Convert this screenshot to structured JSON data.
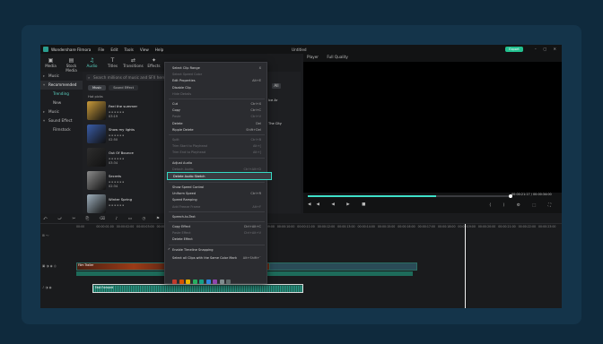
{
  "app": {
    "name": "Wondershare Filmora",
    "document": "Untitled",
    "export_label": "Export"
  },
  "menubar": [
    "File",
    "Edit",
    "Tools",
    "View",
    "Help"
  ],
  "window_controls": "– ▢ ✕",
  "library_tabs": [
    {
      "label": "Media",
      "icon": "▣"
    },
    {
      "label": "Stock Media",
      "icon": "▤"
    },
    {
      "label": "Audio",
      "icon": "♫"
    },
    {
      "label": "Titles",
      "icon": "T"
    },
    {
      "label": "Transitions",
      "icon": "⇄"
    },
    {
      "label": "Effects",
      "icon": "✦"
    }
  ],
  "sidebar": [
    {
      "label": "Music",
      "type": "group"
    },
    {
      "label": "Recommended",
      "type": "group-open",
      "selected": true
    },
    {
      "label": "Trending",
      "type": "sub",
      "highlight": true
    },
    {
      "label": "New",
      "type": "sub"
    },
    {
      "label": "Music",
      "type": "group"
    },
    {
      "label": "Sound Effect",
      "type": "group-open"
    },
    {
      "label": "Filmstock",
      "type": "sub"
    }
  ],
  "search": {
    "placeholder": "Search millions of music and SFX here"
  },
  "chips": [
    "Music",
    "Sound Effect"
  ],
  "section_label": "Hot picks",
  "items": [
    {
      "name": "Feel the summer",
      "duration": "03:19",
      "color": "#c99a3a"
    },
    {
      "name": "Show my lights",
      "duration": "02:50",
      "color": "#3a5da8"
    },
    {
      "name": "Out Of Bounce",
      "duration": "03:34",
      "color": "#2e2e2e"
    },
    {
      "name": "Secrets",
      "duration": "02:34",
      "color": "#8c8c8c"
    },
    {
      "name": "Winter Spring",
      "duration": "",
      "color": "#9fb0bd"
    }
  ],
  "right_col": [
    "Ice Ar",
    "The City"
  ],
  "all_label": "All",
  "player": {
    "label": "Player",
    "quality": "Full Quality",
    "time": "00:00:21:17",
    "total": "00:00:34:00"
  },
  "ruler_ticks": [
    "00:00",
    "00:00:01:00",
    "00:00:02:00",
    "00:00:03:00",
    "00:00:04:00",
    "00:00:05:00",
    "00:00:06:00",
    "00:00:07:00",
    "00:00:08:00",
    "00:00:09:00",
    "00:00:10:00",
    "00:00:11:00",
    "00:00:12:00",
    "00:00:13:00",
    "00:00:14:00",
    "00:00:15:00",
    "00:00:16:00",
    "00:00:17:00",
    "00:00:18:00",
    "00:00:19:00",
    "00:00:20:00",
    "00:00:21:00",
    "00:00:22:00",
    "00:00:23:00"
  ],
  "timeline": {
    "video_clip": "Film Trailer",
    "audio_clip": "Fast Forward"
  },
  "context_menu": {
    "items": [
      {
        "label": "Select Clip Range",
        "key": "X",
        "disabled": false
      },
      {
        "label": "Select Speed Color",
        "key": "",
        "disabled": true
      },
      {
        "label": "Edit Properties",
        "key": "Alt+E",
        "disabled": false
      },
      {
        "label": "Disable Clip",
        "key": "",
        "disabled": false
      },
      {
        "label": "Hide Details",
        "key": "",
        "disabled": true
      },
      {
        "label": "Cut",
        "key": "Ctrl+X",
        "disabled": false
      },
      {
        "label": "Copy",
        "key": "Ctrl+C",
        "disabled": false
      },
      {
        "label": "Paste",
        "key": "Ctrl+V",
        "disabled": true
      },
      {
        "label": "Delete",
        "key": "Del",
        "disabled": false
      },
      {
        "label": "Ripple Delete",
        "key": "Shift+Del",
        "disabled": false
      },
      {
        "label": "Split",
        "key": "Ctrl+B",
        "disabled": true
      },
      {
        "label": "Trim Start to Playhead",
        "key": "Alt+[",
        "disabled": true
      },
      {
        "label": "Trim End to Playhead",
        "key": "Alt+]",
        "disabled": true
      },
      {
        "label": "Adjust Audio",
        "key": "",
        "disabled": false
      },
      {
        "label": "Detach Audio",
        "key": "Ctrl+Alt+D",
        "disabled": true
      },
      {
        "label": "Delete Audio Sketch",
        "key": "",
        "disabled": false,
        "selected": true
      },
      {
        "label": "Show Speed Control",
        "key": "",
        "disabled": false
      },
      {
        "label": "Uniform Speed",
        "key": "Ctrl+R",
        "disabled": false
      },
      {
        "label": "Speed Ramping",
        "key": "",
        "disabled": false
      },
      {
        "label": "Add Freeze Frame",
        "key": "Alt+F",
        "disabled": true
      },
      {
        "label": "Speech-to-Text",
        "key": "",
        "disabled": false
      },
      {
        "label": "Copy Effect",
        "key": "Ctrl+Alt+C",
        "disabled": false
      },
      {
        "label": "Paste Effect",
        "key": "Ctrl+Alt+V",
        "disabled": true
      },
      {
        "label": "Delete Effect",
        "key": "",
        "disabled": false
      },
      {
        "label": "Enable Timeline Snapping",
        "key": "",
        "disabled": false,
        "checked": true
      },
      {
        "label": "Select all Clips with the Same Color Mark",
        "key": "Alt+Shift+`",
        "disabled": false
      }
    ],
    "swatch_colors": [
      "#c0392b",
      "#d35400",
      "#e6b400",
      "#27ae60",
      "#16a085",
      "#2e86de",
      "#8e44ad",
      "#7f8c8d",
      "#5f6a6a"
    ]
  }
}
